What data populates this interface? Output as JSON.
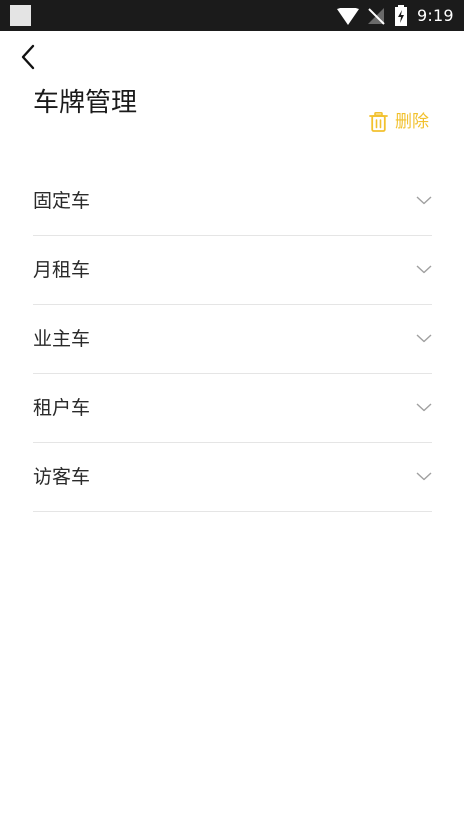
{
  "status_bar": {
    "time": "9:19",
    "icons": [
      "notification-square-icon",
      "wifi-icon",
      "no-signal-icon",
      "battery-charging-icon"
    ]
  },
  "header": {
    "back_icon": "chevron-left-icon",
    "title": "车牌管理",
    "delete_label": "删除",
    "delete_icon": "trash-icon",
    "accent_color": "#f2c12e"
  },
  "categories": [
    {
      "label": "固定车",
      "icon": "chevron-down-icon"
    },
    {
      "label": "月租车",
      "icon": "chevron-down-icon"
    },
    {
      "label": "业主车",
      "icon": "chevron-down-icon"
    },
    {
      "label": "租户车",
      "icon": "chevron-down-icon"
    },
    {
      "label": "访客车",
      "icon": "chevron-down-icon"
    }
  ]
}
